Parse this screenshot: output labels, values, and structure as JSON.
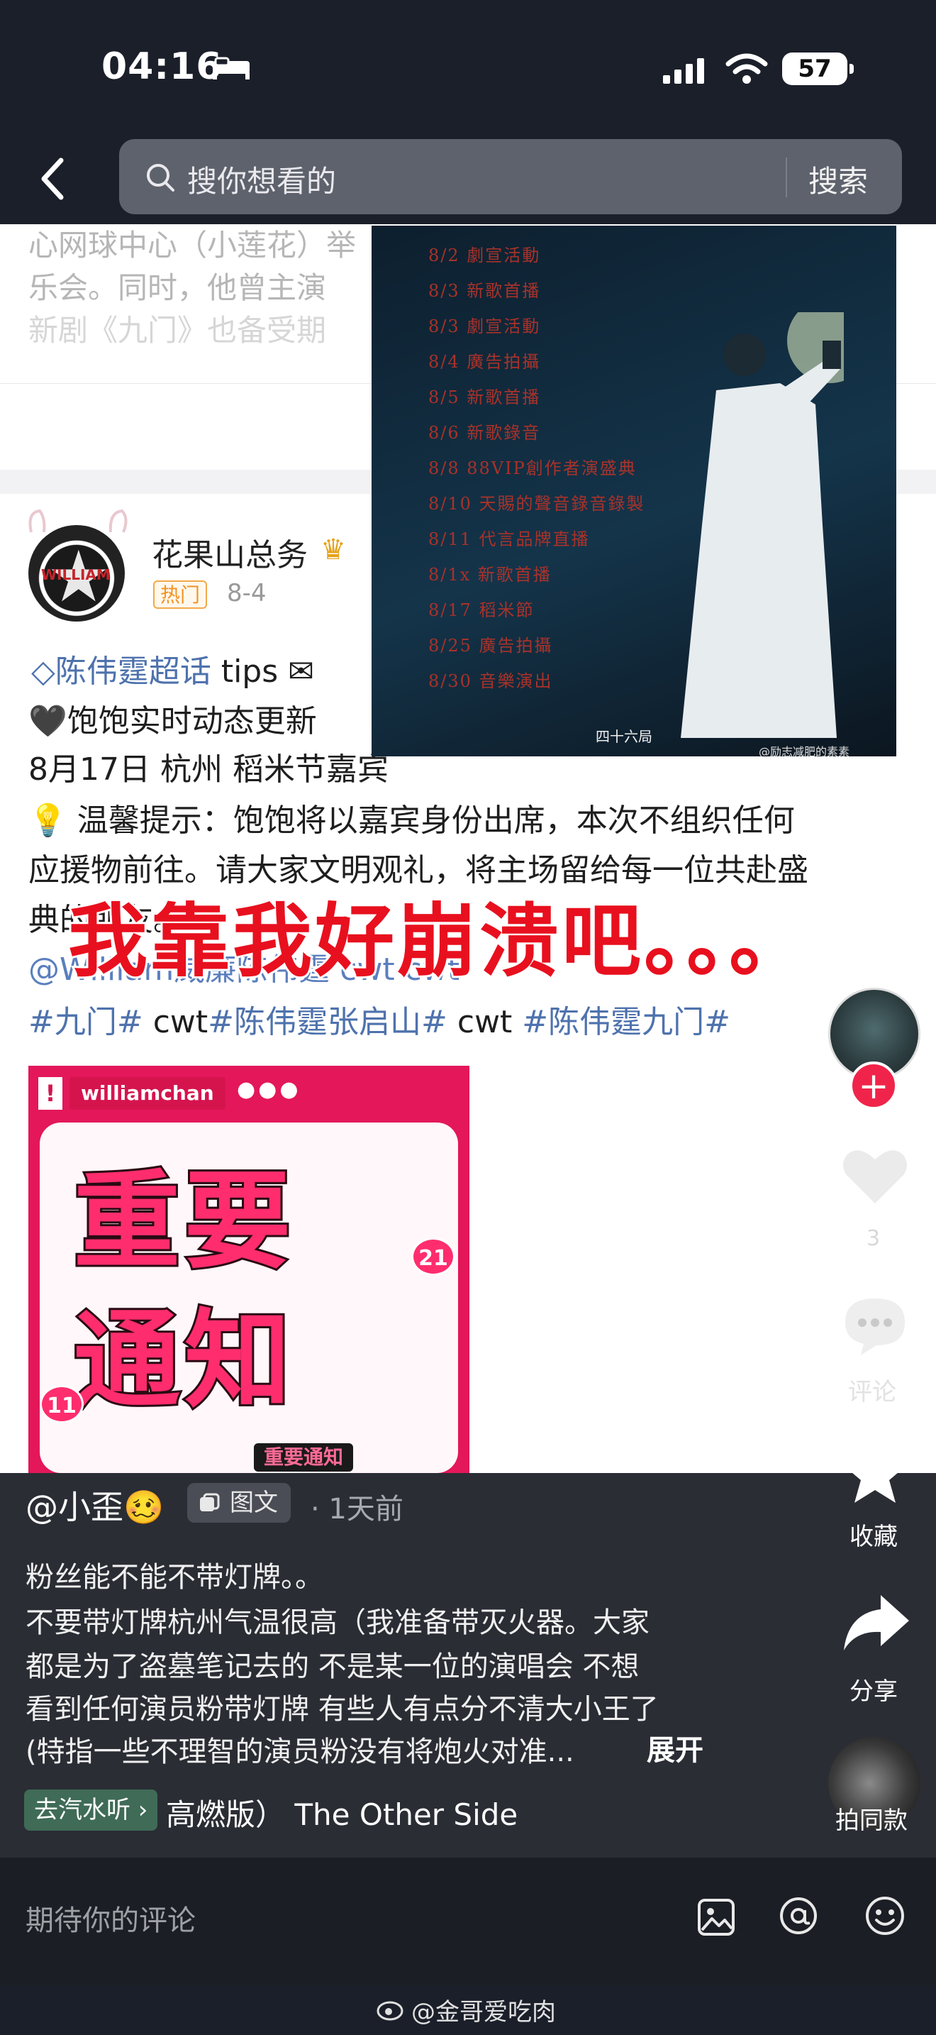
{
  "status_bar": {
    "time": "04:16",
    "battery": "57"
  },
  "search": {
    "placeholder": "搜你想看的",
    "button_label": "搜索"
  },
  "previous_post": {
    "lines": [
      "心网球中心（小莲花）举",
      "乐会。同时，他曾主演",
      "新剧《九门》也备受期"
    ]
  },
  "post": {
    "author": "花果山总务",
    "badge": "热门",
    "date": "8-4",
    "avatar_text": "WILLIAM",
    "topic": "陈伟霆超话",
    "topic_suffix": " tips",
    "line2": "🖤饱饱实时动态更新",
    "line3": "8月17日 杭州 稻米节嘉宾",
    "line4": "💡 温馨提示：饱饱将以嘉宾身份出席，本次不组织任何",
    "line5": "应援物前往。请大家文明观礼，将主场留给每一位共赴盛",
    "line6": "典的朋友。",
    "line7": "@William威廉陈伟霆  cwt  cwt",
    "hashtags": [
      {
        "tag": "#九门#",
        "plain": " cwt"
      },
      {
        "tag": "#陈伟霆张启山#",
        "plain": " cwt "
      },
      {
        "tag": "#陈伟霆九门#",
        "plain": ""
      }
    ]
  },
  "schedule_image": {
    "entries": [
      "8/2  劇宣活動",
      "8/3  新歌首播",
      "8/3  劇宣活動",
      "8/4  廣告拍攝",
      "8/5  新歌首播",
      "8/6  新歌錄音",
      "8/8  88VIP創作者演盛典",
      "8/10  天賜的聲音錄音錄製",
      "8/11  代言品牌直播",
      "8/1x  新歌首播",
      "8/17  稻米節",
      "8/25  廣告拍攝",
      "8/30  音樂演出"
    ],
    "footer": "四十六局",
    "credit": "@励志减肥的素素"
  },
  "overlay_caption": "我靠我好崩溃吧。。。",
  "notice_image": {
    "tag": "williamchan",
    "title_line1": "重要",
    "title_line2": "通知",
    "num_a": "21",
    "num_b": "11",
    "bottom": "重要通知"
  },
  "rail": {
    "like_count": "3",
    "comment_label": "评论",
    "collect_label": "收藏",
    "share_label": "分享",
    "same_label": "拍同款"
  },
  "info": {
    "poster": "@小歪🥴",
    "type": "图文",
    "time": "· 1天前",
    "caption_lines": [
      "粉丝能不能不带灯牌。。",
      "不要带灯牌杭州气温很高（我准备带灭火器。大家",
      "都是为了盗墓笔记去的 不是某一位的演唱会 不想",
      "看到任何演员粉带灯牌 有些人有点分不清大小王了",
      "(特指一些不理智的演员粉没有将炮火对准..."
    ],
    "expand": "展开",
    "music_chip": "去汽水听 ›",
    "music_title": "高燃版）  The Other Side"
  },
  "comment_bar": {
    "placeholder": "期待你的评论"
  },
  "watermark": "@金哥爱吃肉",
  "colors": {
    "accent_red": "#e8101e",
    "topic_blue": "#4e72ad",
    "follow_red": "#f0244a"
  }
}
